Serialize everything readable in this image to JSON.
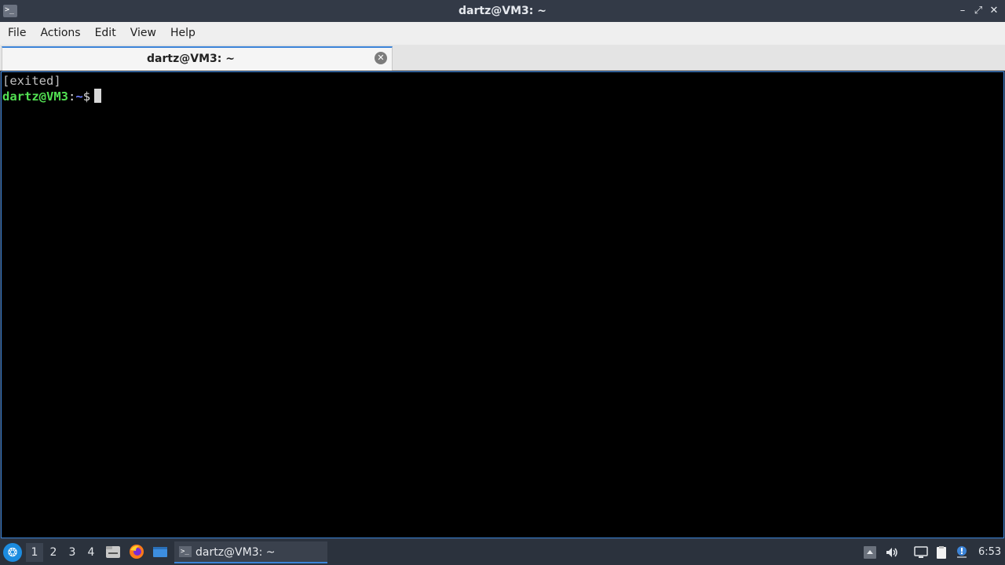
{
  "window": {
    "title": "dartz@VM3: ~",
    "app_icon_glyph": ">_",
    "minimize_glyph": "–",
    "maximize_glyph": "⤢",
    "close_glyph": "✕"
  },
  "menubar": {
    "items": [
      "File",
      "Actions",
      "Edit",
      "View",
      "Help"
    ]
  },
  "tabs": [
    {
      "label": "dartz@VM3: ~",
      "close_glyph": "✕"
    }
  ],
  "terminal": {
    "line1": "[exited]",
    "prompt_user": "dartz@VM3",
    "prompt_sep": ":",
    "prompt_path": "~",
    "prompt_symbol": "$"
  },
  "taskbar": {
    "workspaces": [
      "1",
      "2",
      "3",
      "4"
    ],
    "active_workspace": "1",
    "task_label": "dartz@VM3: ~",
    "clock": "6:53",
    "accent": "#3c84d8"
  },
  "colors": {
    "terminal_bg": "#000000",
    "prompt_user": "#52e052",
    "prompt_path": "#6f7fff",
    "accent": "#3c84d8"
  }
}
